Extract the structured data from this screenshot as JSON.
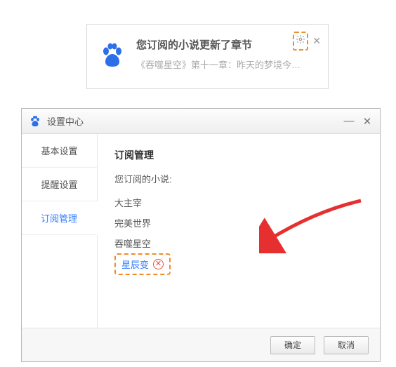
{
  "notification": {
    "title": "您订阅的小说更新了章节",
    "subtitle": "《吞噬星空》第十一章：昨天的梦境今…"
  },
  "dialog": {
    "title": "设置中心",
    "sidebar": {
      "items": [
        {
          "label": "基本设置"
        },
        {
          "label": "提醒设置"
        },
        {
          "label": "订阅管理"
        }
      ]
    },
    "content": {
      "heading": "订阅管理",
      "sub_label": "您订阅的小说:",
      "novels": [
        {
          "name": "大主宰"
        },
        {
          "name": "完美世界"
        },
        {
          "name": "吞噬星空"
        },
        {
          "name": "星辰变"
        }
      ]
    },
    "footer": {
      "ok": "确定",
      "cancel": "取消"
    }
  }
}
